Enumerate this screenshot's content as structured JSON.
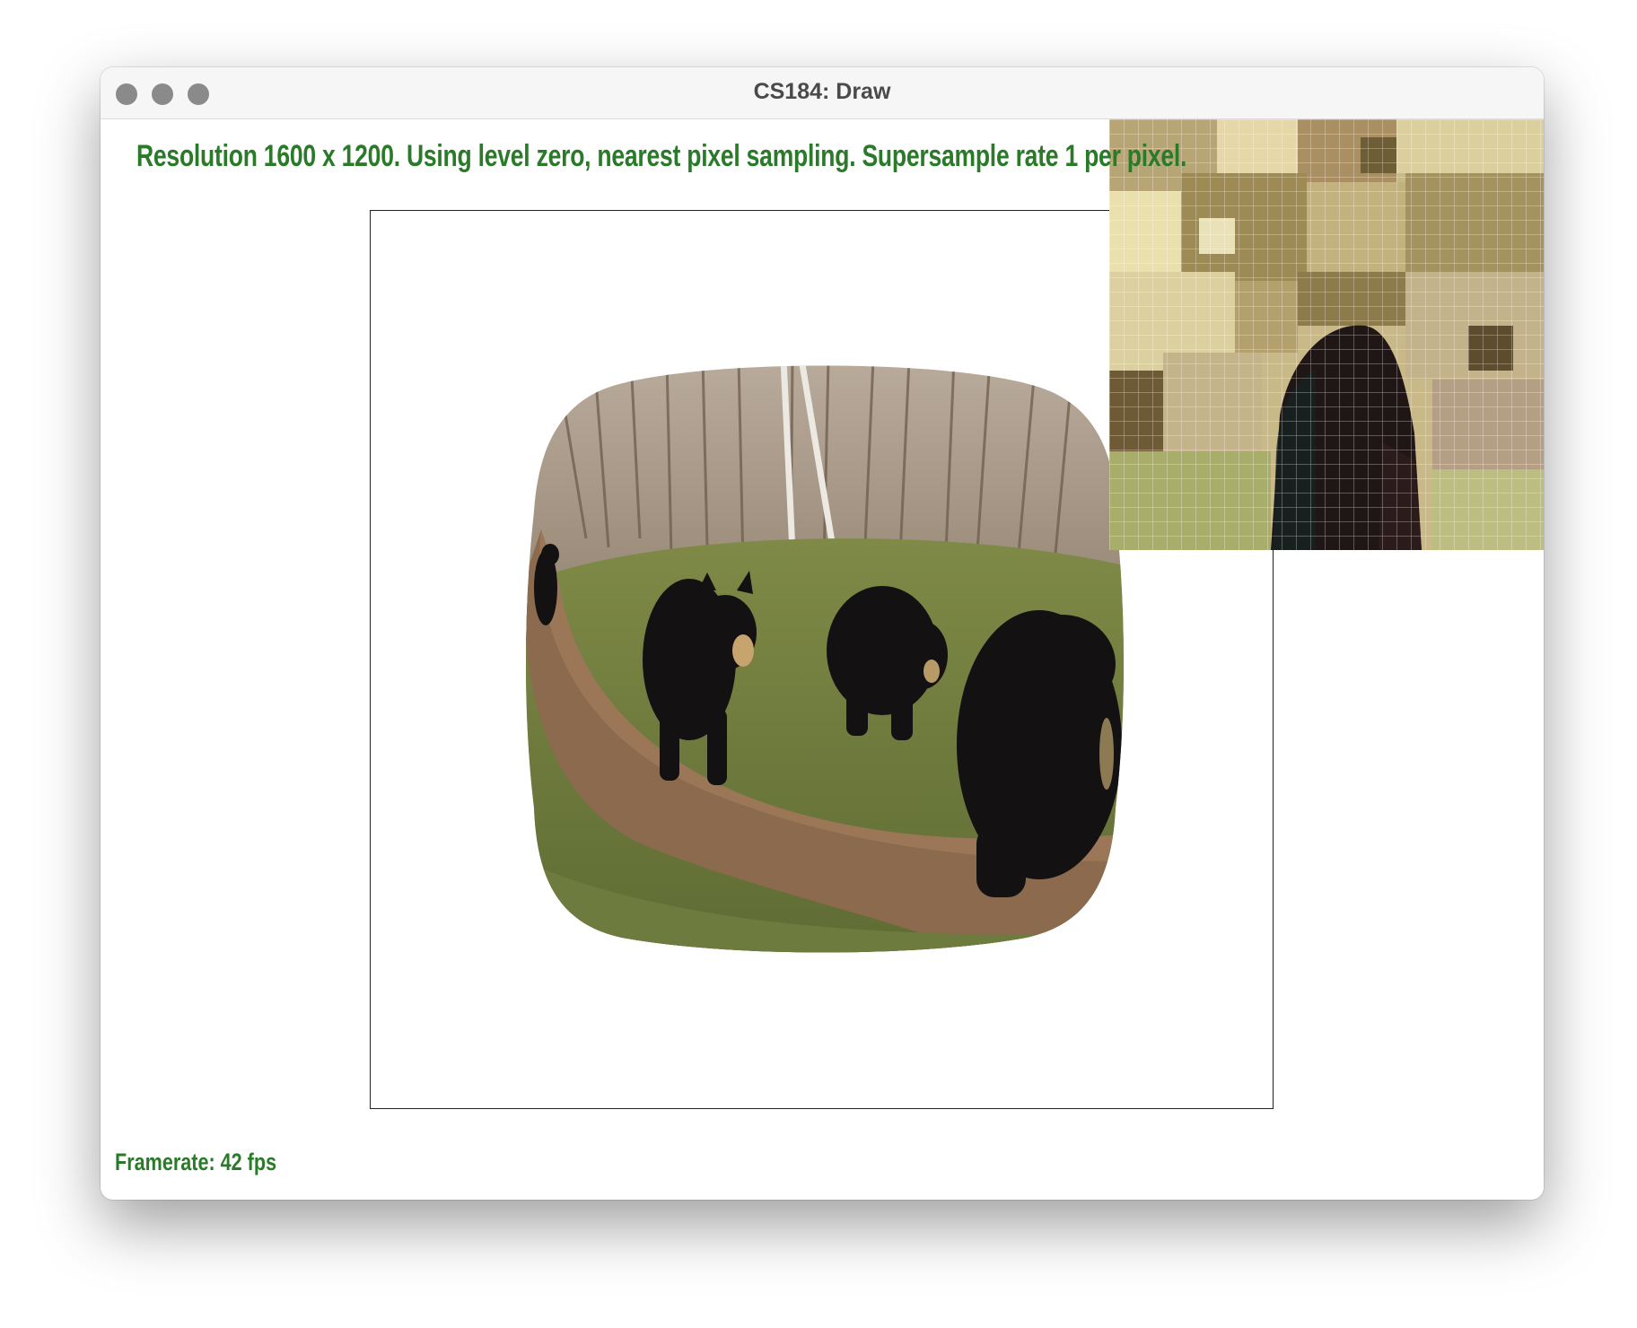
{
  "window": {
    "title": "CS184: Draw",
    "traffic_lights": [
      "close",
      "minimize",
      "maximize"
    ]
  },
  "status": {
    "text": "Resolution 1600 x 1200. Using level zero, nearest pixel sampling. Supersample rate 1 per pixel.",
    "color": "#2a7a2a"
  },
  "framerate": {
    "text": "Framerate: 42 fps",
    "color": "#2a7a2a"
  },
  "canvas": {
    "image_subject": "four black bears on a forest trail, warped into a rounded square",
    "zoom_inset_subject": "magnified pixel grid of the textured image"
  },
  "colors": {
    "window_bg": "#ffffff",
    "titlebar_bg": "#f6f6f6",
    "traffic_light": "#8a8a8a",
    "text_green": "#2a7a2a"
  }
}
